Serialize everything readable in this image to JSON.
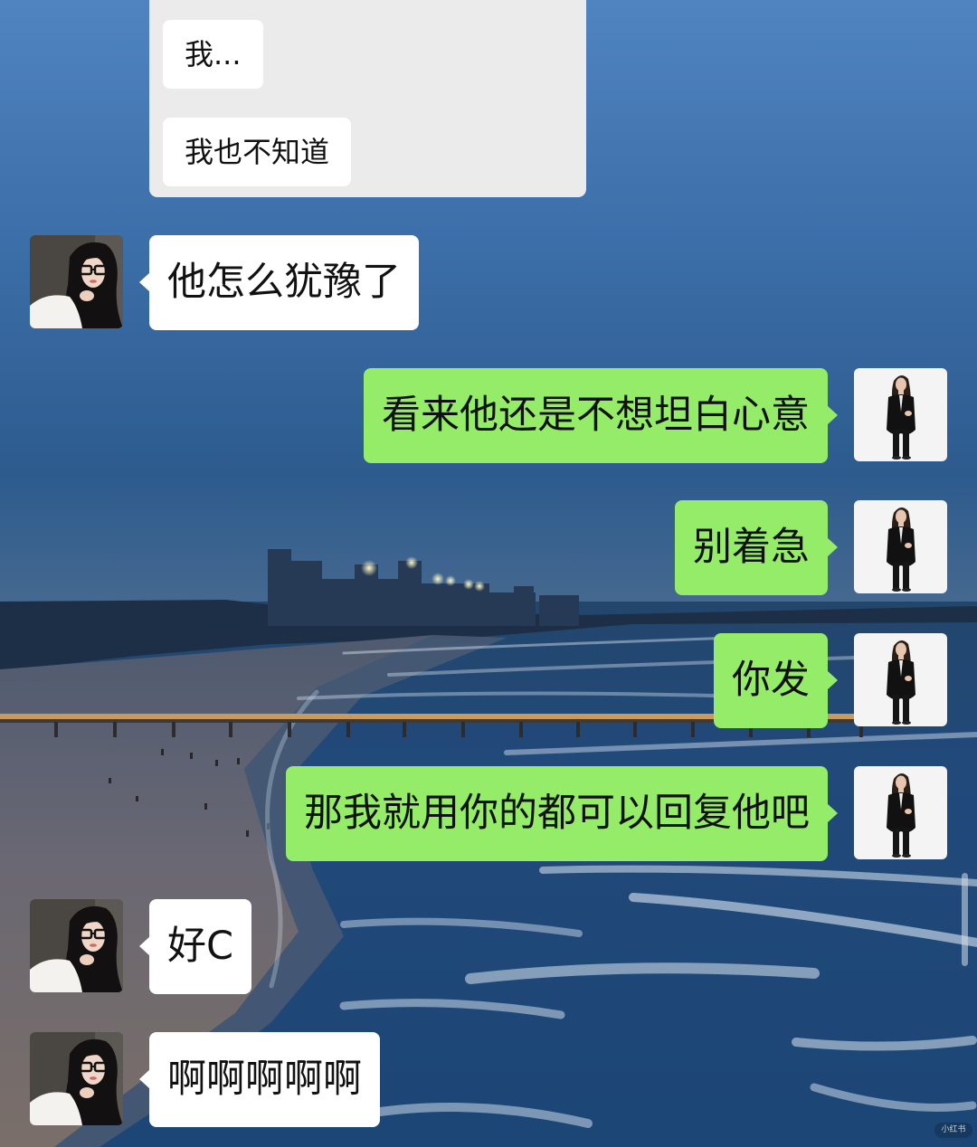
{
  "quoted_card": {
    "messages": [
      "我...",
      "我也不知道"
    ]
  },
  "messages": [
    {
      "outgoing": false,
      "avatar": "contact-avatar-icon",
      "text": "他怎么犹豫了"
    },
    {
      "outgoing": true,
      "avatar": "my-avatar-icon",
      "text": "看来他还是不想坦白心意"
    },
    {
      "outgoing": true,
      "avatar": "my-avatar-icon",
      "text": "别着急"
    },
    {
      "outgoing": true,
      "avatar": "my-avatar-icon",
      "text": "你发"
    },
    {
      "outgoing": true,
      "avatar": "my-avatar-icon",
      "text": "那我就用你的都可以回复他吧"
    },
    {
      "outgoing": false,
      "avatar": "contact-avatar-icon",
      "text": "好C"
    },
    {
      "outgoing": false,
      "avatar": "contact-avatar-icon",
      "text": "啊啊啊啊啊"
    }
  ],
  "watermark": "小红书",
  "colors": {
    "outgoing_bubble": "#95ec69",
    "incoming_bubble": "#ffffff",
    "quoted_card": "#ebebeb",
    "text": "#111111"
  }
}
